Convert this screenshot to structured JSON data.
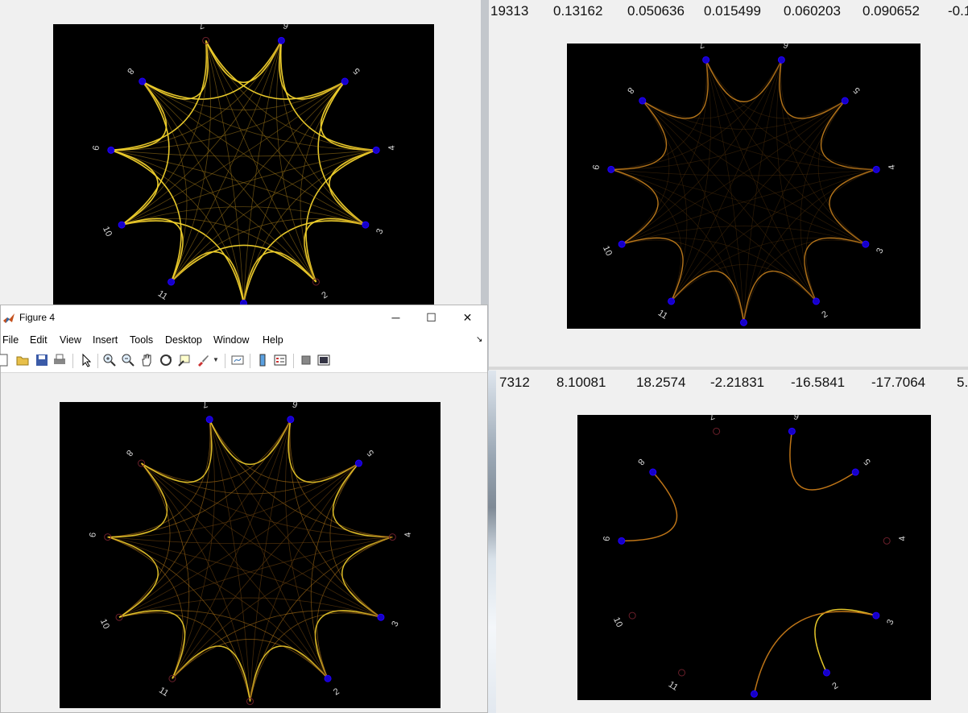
{
  "top_right_numbers": [
    "19313",
    "0.13162",
    "0.050636",
    "0.015499",
    "0.060203",
    "0.090652",
    "-0.1"
  ],
  "bottom_right_numbers": [
    "7312",
    "8.10081",
    "18.2574",
    "-2.21831",
    "-16.5841",
    "-17.7064",
    "5."
  ],
  "figure4": {
    "title": "Figure 4",
    "menu": [
      "File",
      "Edit",
      "View",
      "Insert",
      "Tools",
      "Desktop",
      "Window",
      "Help"
    ],
    "minimize": "─",
    "maximize": "☐",
    "close": "✕",
    "dock_arrow": "↘"
  },
  "toolbar_icons": [
    "new-figure-icon",
    "open-file-icon",
    "save-icon",
    "print-icon",
    "pointer-icon",
    "zoom-in-icon",
    "zoom-out-icon",
    "pan-icon",
    "rotate-3d-icon",
    "data-cursor-icon",
    "brush-icon",
    "link-plot-icon",
    "colorbar-icon",
    "legend-icon",
    "hide-plot-tools-icon",
    "show-plot-tools-icon"
  ],
  "node_labels": [
    "1",
    "2",
    "3",
    "4",
    "5",
    "6",
    "7",
    "8",
    "9",
    "10",
    "11"
  ],
  "colors": {
    "node_active": "#1500c8",
    "node_inactive": "#3a0a18",
    "edge_bright": "#f2d22c",
    "edge_dim": "#7a4a10",
    "label": "#d8d8d8",
    "background": "#000000"
  },
  "panels": [
    {
      "id": "top-left",
      "style": "star",
      "palette": "bright",
      "inactive_nodes": [
        2,
        7
      ]
    },
    {
      "id": "top-right",
      "style": "star",
      "palette": "brown",
      "inactive_nodes": []
    },
    {
      "id": "figure4",
      "style": "star",
      "palette": "mixed",
      "inactive_nodes": [
        1,
        4,
        8,
        9,
        10,
        11
      ]
    },
    {
      "id": "bottom-right",
      "style": "sparse",
      "palette": "brown",
      "inactive_nodes": [
        4,
        7,
        10,
        11
      ],
      "edges": [
        [
          9,
          8
        ],
        [
          6,
          5
        ],
        [
          2,
          3
        ],
        [
          1,
          3
        ]
      ]
    }
  ]
}
